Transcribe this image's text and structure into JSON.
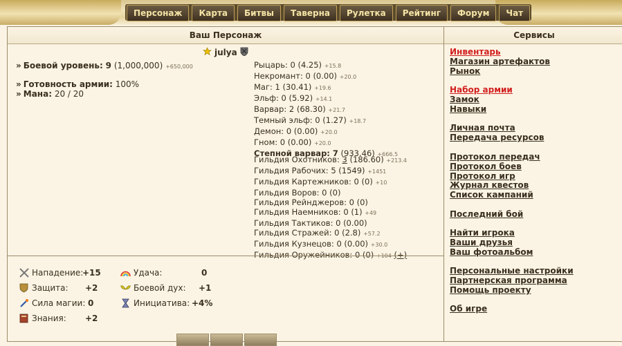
{
  "nav": [
    "Персонаж",
    "Карта",
    "Битвы",
    "Таверна",
    "Рулетка",
    "Рейтинг",
    "Форум",
    "Чат"
  ],
  "main_title": "Ваш Персонаж",
  "services_title": "Сервисы",
  "character": {
    "name": "julya",
    "combat_level_label": "Боевой уровень:",
    "combat_level": "9",
    "combat_exp": "(1,000,000)",
    "combat_exp_next": "+650,000",
    "army_label": "Готовность армии:",
    "army_value": "100%",
    "mana_label": "Мана:",
    "mana_value": "20 / 20"
  },
  "factions": [
    {
      "text": "Рыцарь: 0 (4.25)",
      "delta": "+15.8",
      "bold": false
    },
    {
      "text": "Некромант: 0 (0.00)",
      "delta": "+20.0",
      "bold": false
    },
    {
      "text": "Маг: 1 (30.41)",
      "delta": "+19.6",
      "bold": false
    },
    {
      "text": "Эльф: 0 (5.92)",
      "delta": "+14.1",
      "bold": false
    },
    {
      "text": "Варвар: 2 (68.30)",
      "delta": "+21.7",
      "bold": false
    },
    {
      "text": "Темный эльф: 0 (1.27)",
      "delta": "+18.7",
      "bold": false
    },
    {
      "text": "Демон: 0 (0.00)",
      "delta": "+20.0",
      "bold": false
    },
    {
      "text": "Гном: 0 (0.00)",
      "delta": "+20.0",
      "bold": false
    },
    {
      "text_bold": "Степной варвар: 7",
      "text": " (933.46)",
      "delta": "+666.5",
      "bold": true
    }
  ],
  "guilds": [
    {
      "pre": "Гильдия Охотников: ",
      "link": "3",
      "post": " (186.60)",
      "delta": "+213.4"
    },
    {
      "pre": "Гильдия Рабочих: 5 (1549)",
      "link": "",
      "post": "",
      "delta": "+1451"
    },
    {
      "pre": "Гильдия Картежников: 0 (0)",
      "link": "",
      "post": "",
      "delta": "+10"
    },
    {
      "pre": "Гильдия Воров: 0 (0)",
      "link": "",
      "post": "",
      "delta": ""
    },
    {
      "pre": "Гильдия Рейнджеров: 0 (0)",
      "link": "",
      "post": "",
      "delta": ""
    },
    {
      "pre": "Гильдия Наемников: 0 (1)",
      "link": "",
      "post": "",
      "delta": "+49"
    },
    {
      "pre": "Гильдия Тактиков: 0 (0.00)",
      "link": "",
      "post": "",
      "delta": ""
    },
    {
      "pre": "Гильдия Стражей: 0 (2.8)",
      "link": "",
      "post": "",
      "delta": "+57.2"
    },
    {
      "pre": "Гильдия Кузнецов: 0 (0.00)",
      "link": "",
      "post": "",
      "delta": "+30.0"
    },
    {
      "pre": "Гильдия Оружейников: 0 (0)",
      "link": "",
      "post": "",
      "delta": "+104",
      "plus": "(+)"
    }
  ],
  "attributes": {
    "attack_label": "Нападение:",
    "attack": "+15",
    "defense_label": "Защита:",
    "defense": "+2",
    "spellpower_label": "Сила магии:",
    "spellpower": "0",
    "knowledge_label": "Знания:",
    "knowledge": "+2",
    "luck_label": "Удача:",
    "luck": "0",
    "morale_label": "Боевой дух:",
    "morale": "+1",
    "initiative_label": "Инициатива:",
    "initiative": "+4%"
  },
  "services": [
    {
      "label": "Инвентарь",
      "red": true
    },
    {
      "label": "Магазин артефактов",
      "red": false
    },
    {
      "label": "Рынок",
      "red": false
    },
    {
      "label": "Набор армии",
      "red": true
    },
    {
      "label": "Замок",
      "red": false
    },
    {
      "label": "Навыки",
      "red": false
    },
    {
      "label": "Личная почта",
      "red": false
    },
    {
      "label": "Передача ресурсов",
      "red": false
    },
    {
      "label": "Протокол передач",
      "red": false
    },
    {
      "label": "Протокол боев",
      "red": false
    },
    {
      "label": "Протокол игр",
      "red": false
    },
    {
      "label": "Журнал квестов",
      "red": false
    },
    {
      "label": "Список кампаний",
      "red": false
    },
    {
      "label": "Последний бой",
      "red": false
    },
    {
      "label": "Найти игрока",
      "red": false
    },
    {
      "label": "Ваши друзья",
      "red": false
    },
    {
      "label": "Ваш фотоальбом",
      "red": false
    },
    {
      "label": "Персональные настройки",
      "red": false
    },
    {
      "label": "Партнерская программа",
      "red": false
    },
    {
      "label": "Помощь проекту",
      "red": false
    },
    {
      "label": "Об игре",
      "red": false
    }
  ]
}
